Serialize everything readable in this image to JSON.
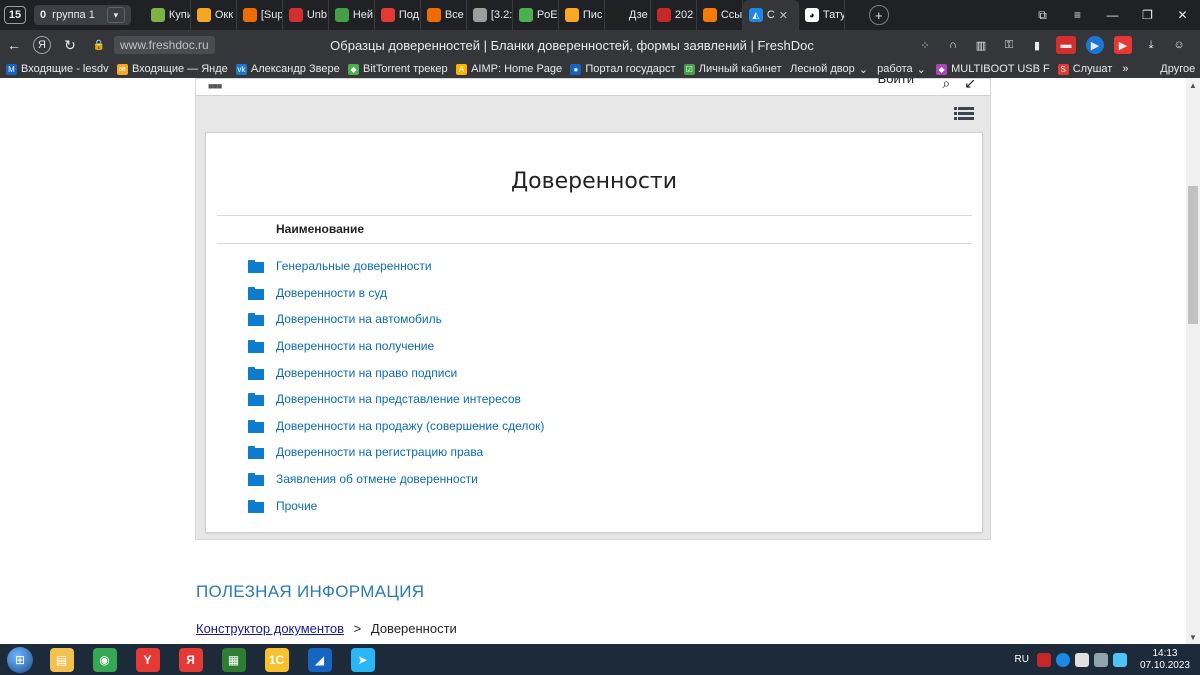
{
  "tabstrip": {
    "tab_count": "15",
    "group_badge": "0",
    "group_name": "группа 1",
    "tabs": [
      {
        "label": "Купи",
        "color": "#7cb342"
      },
      {
        "label": "Окк",
        "color": "#f5a623"
      },
      {
        "label": "[Sup",
        "color": "#ef6c00"
      },
      {
        "label": "Unb",
        "color": "#d32f2f"
      },
      {
        "label": "Ней",
        "color": "#43a047"
      },
      {
        "label": "Под",
        "color": "#e53935"
      },
      {
        "label": "Все",
        "color": "#ef6c00"
      },
      {
        "label": "[3.2:",
        "color": "#9e9e9e"
      },
      {
        "label": "PoE",
        "color": "#4caf50"
      },
      {
        "label": "Пис",
        "color": "#f9a825"
      },
      {
        "label": "Дзе",
        "color": "#212121"
      },
      {
        "label": "202",
        "color": "#c62828"
      },
      {
        "label": "Ссы",
        "color": "#f57c00"
      }
    ],
    "active_tab": {
      "label": "С",
      "close": "✕"
    },
    "after_active_tab": {
      "label": "Тату"
    },
    "new_tab": "+"
  },
  "addressbar": {
    "url": "www.freshdoc.ru",
    "page_title": "Образцы доверенностей | Бланки доверенностей, формы заявлений | FreshDoc"
  },
  "bookmarks": [
    {
      "label": "Входящие - lesdv",
      "color": "#1565c0",
      "icon": "M"
    },
    {
      "label": "Входящие — Янде",
      "color": "#f9a825",
      "icon": "✉"
    },
    {
      "label": "Александр Звере",
      "color": "#1976d2",
      "icon": "vk"
    },
    {
      "label": "BitTorrent трекер",
      "color": "#4caf50",
      "icon": "◆"
    },
    {
      "label": "AIMP: Home Page",
      "color": "#ffb300",
      "icon": "A"
    },
    {
      "label": "Портал государст",
      "color": "#1565c0",
      "icon": "●"
    },
    {
      "label": "Личный кабинет",
      "color": "#43a047",
      "icon": "☑"
    },
    {
      "label": "Лесной двор",
      "color": "transparent",
      "icon": ""
    },
    {
      "label": "работа",
      "color": "transparent",
      "icon": ""
    },
    {
      "label": "MULTIBOOT USB F",
      "color": "#ab47bc",
      "icon": "◆"
    },
    {
      "label": "Слушат",
      "color": "#e53935",
      "icon": "S"
    }
  ],
  "bookmarks_overflow": "»",
  "bookmarks_other": "Другое",
  "site": {
    "login": "Войти",
    "card_title": "Доверенности",
    "column_header": "Наименование",
    "items": [
      "Генеральные доверенности",
      "Доверенности в суд",
      "Доверенности на автомобиль",
      "Доверенности на получение",
      "Доверенности на право подписи",
      "Доверенности на представление интересов",
      "Доверенности на продажу (совершение сделок)",
      "Доверенности на регистрацию права",
      "Заявления об отмене доверенности",
      "Прочие"
    ],
    "useful_heading": "ПОЛЕЗНАЯ ИНФОРМАЦИЯ",
    "breadcrumb_link": "Конструктор документов",
    "breadcrumb_sep": ">",
    "breadcrumb_current": "Доверенности"
  },
  "taskbar": {
    "apps": [
      {
        "name": "explorer",
        "color": "#f2c14e",
        "glyph": "▤"
      },
      {
        "name": "chrome",
        "color": "#34a853",
        "glyph": "◉"
      },
      {
        "name": "yandex-browser",
        "color": "#e53935",
        "glyph": "Y"
      },
      {
        "name": "yandex",
        "color": "#e53935",
        "glyph": "Я"
      },
      {
        "name": "calculator",
        "color": "#2e7d32",
        "glyph": "▦"
      },
      {
        "name": "1c",
        "color": "#fbc02d",
        "glyph": "1С"
      },
      {
        "name": "app-swoosh",
        "color": "#1565c0",
        "glyph": "◢"
      },
      {
        "name": "telegram",
        "color": "#29b6f6",
        "glyph": "➤"
      }
    ],
    "lang": "RU",
    "time": "14:13",
    "date": "07.10.2023"
  }
}
